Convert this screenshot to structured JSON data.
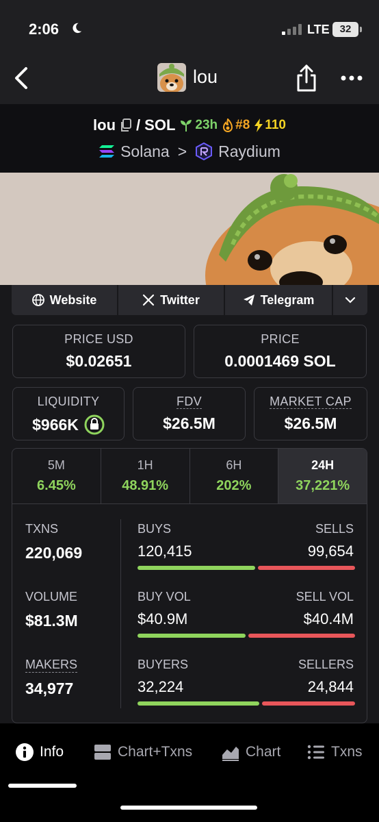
{
  "status_bar": {
    "time": "2:06",
    "network": "LTE",
    "battery": "32"
  },
  "nav": {
    "title": "lou"
  },
  "token": {
    "symbol": "lou",
    "pair_sep": "/",
    "quote": "SOL",
    "age": "23h",
    "rank": "#8",
    "boost": "110",
    "chain": "Solana",
    "chevron": ">",
    "dex": "Raydium"
  },
  "links": {
    "website": "Website",
    "twitter": "Twitter",
    "telegram": "Telegram"
  },
  "price_usd": {
    "label": "PRICE USD",
    "value": "$0.02651"
  },
  "price": {
    "label": "PRICE",
    "value": "0.0001469 SOL"
  },
  "liquidity": {
    "label": "LIQUIDITY",
    "value": "$966K"
  },
  "fdv": {
    "label": "FDV",
    "value": "$26.5M"
  },
  "market_cap": {
    "label": "MARKET CAP",
    "value": "$26.5M"
  },
  "timeframes": [
    {
      "label": "5M",
      "change": "6.45%"
    },
    {
      "label": "1H",
      "change": "48.91%"
    },
    {
      "label": "6H",
      "change": "202%"
    },
    {
      "label": "24H",
      "change": "37,221%"
    }
  ],
  "stats": {
    "txns": {
      "label": "TXNS",
      "value": "220,069"
    },
    "volume": {
      "label": "VOLUME",
      "value": "$81.3M"
    },
    "makers": {
      "label": "MAKERS",
      "value": "34,977"
    },
    "buys": {
      "label": "BUYS",
      "value": "120,415",
      "share": 0.547
    },
    "sells": {
      "label": "SELLS",
      "value": "99,654"
    },
    "buy_vol": {
      "label": "BUY VOL",
      "value": "$40.9M",
      "share": 0.503
    },
    "sell_vol": {
      "label": "SELL VOL",
      "value": "$40.4M"
    },
    "buyers": {
      "label": "BUYERS",
      "value": "32,224",
      "share": 0.565
    },
    "sellers": {
      "label": "SELLERS",
      "value": "24,844"
    }
  },
  "tabs": {
    "info": "Info",
    "chart_txns": "Chart+Txns",
    "chart": "Chart",
    "txns": "Txns"
  },
  "colors": {
    "positive": "#8fd45d",
    "negative": "#e8565a",
    "background": "#18181b"
  }
}
